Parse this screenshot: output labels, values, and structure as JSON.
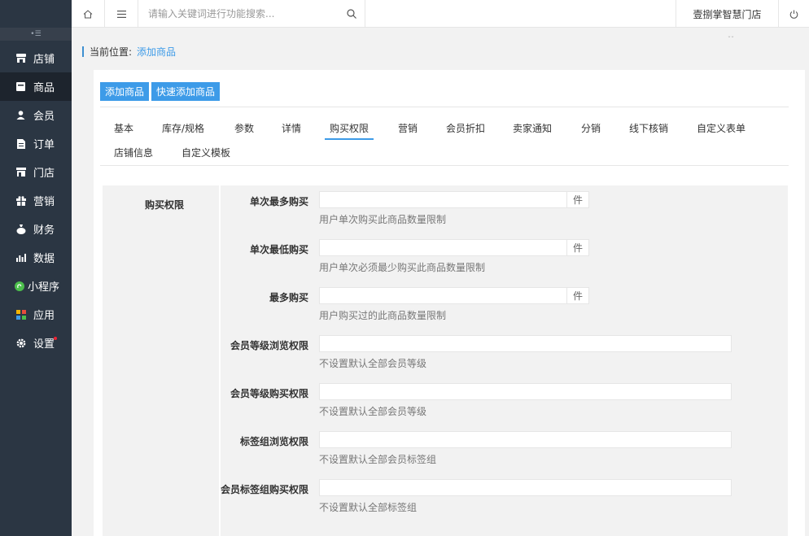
{
  "sidebar": {
    "collapse_icon": "collapse-icon",
    "items": [
      {
        "label": "店铺",
        "icon": "store-icon",
        "active": false
      },
      {
        "label": "商品",
        "icon": "goods-icon",
        "active": true
      },
      {
        "label": "会员",
        "icon": "user-icon",
        "active": false
      },
      {
        "label": "订单",
        "icon": "order-icon",
        "active": false
      },
      {
        "label": "门店",
        "icon": "shop-icon",
        "active": false
      },
      {
        "label": "营销",
        "icon": "gift-icon",
        "active": false
      },
      {
        "label": "财务",
        "icon": "money-bag-icon",
        "active": false
      },
      {
        "label": "数据",
        "icon": "bar-chart-icon",
        "active": false
      },
      {
        "label": "小程序",
        "icon": "mini-program-icon",
        "active": false
      },
      {
        "label": "应用",
        "icon": "apps-icon",
        "active": false
      },
      {
        "label": "设置",
        "icon": "gear-icon",
        "active": false
      }
    ]
  },
  "header": {
    "search_placeholder": "请输入关键词进行功能搜索...",
    "store_name": "壹捌掌智慧门店"
  },
  "breadcrumb": {
    "label": "当前位置:",
    "current": "添加商品"
  },
  "top_buttons": {
    "add": "添加商品",
    "quick_add": "快速添加商品"
  },
  "tabs": [
    {
      "label": "基本"
    },
    {
      "label": "库存/规格"
    },
    {
      "label": "参数"
    },
    {
      "label": "详情"
    },
    {
      "label": "购买权限",
      "active": true
    },
    {
      "label": "营销"
    },
    {
      "label": "会员折扣"
    },
    {
      "label": "卖家通知"
    },
    {
      "label": "分销"
    },
    {
      "label": "线下核销"
    },
    {
      "label": "自定义表单"
    },
    {
      "label": "店铺信息"
    },
    {
      "label": "自定义模板"
    }
  ],
  "form": {
    "section_title": "购买权限",
    "rows": [
      {
        "label": "单次最多购买",
        "value": "",
        "unit": "件",
        "hint": "用户单次购买此商品数量限制"
      },
      {
        "label": "单次最低购买",
        "value": "",
        "unit": "件",
        "hint": "用户单次必须最少购买此商品数量限制"
      },
      {
        "label": "最多购买",
        "value": "",
        "unit": "件",
        "hint": "用户购买过的此商品数量限制"
      },
      {
        "label": "会员等级浏览权限",
        "value": "",
        "hint": "不设置默认全部会员等级"
      },
      {
        "label": "会员等级购买权限",
        "value": "",
        "hint": "不设置默认全部会员等级"
      },
      {
        "label": "标签组浏览权限",
        "value": "",
        "hint": "不设置默认全部会员标签组"
      },
      {
        "label": "会员标签组购买权限",
        "value": "",
        "hint": "不设置默认全部标签组"
      }
    ]
  }
}
